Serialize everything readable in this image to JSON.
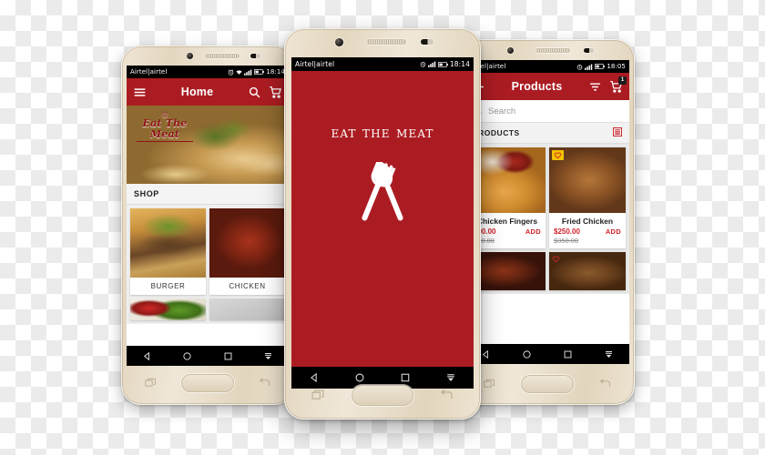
{
  "scene": {
    "background": "transparent-checkerboard",
    "brand_red": "#ab1c22",
    "accent_red": "#d0212a",
    "phone_body_color": "#e8dfd0"
  },
  "phones": {
    "left": {
      "status_bar": {
        "carrier": "Airtel|airtel",
        "time": "18:14"
      },
      "app_bar": {
        "menu_icon": "hamburger-menu-icon",
        "title": "Home",
        "search_icon": "search-icon",
        "cart_icon": "cart-icon"
      },
      "hero": {
        "logo_line1": "Eat The Meat",
        "crown": "♔"
      },
      "section_title": "SHOP",
      "categories": [
        {
          "label": "BURGER"
        },
        {
          "label": "CHICKEN"
        }
      ],
      "nav": [
        "back-triangle-icon",
        "home-circle-icon",
        "recents-square-icon",
        "hide-keyboard-icon"
      ]
    },
    "center": {
      "status_bar": {
        "carrier": "Airtel|airtel",
        "time": "18:14"
      },
      "splash": {
        "title": "Eat the Meat",
        "logo_icon": "fork-and-spoon-icon"
      },
      "nav": [
        "back-triangle-icon",
        "home-circle-icon",
        "recents-square-icon",
        "hide-keyboard-icon"
      ]
    },
    "right": {
      "status_bar": {
        "carrier": "Airtel|airtel",
        "time": "18:05"
      },
      "app_bar": {
        "back_icon": "back-arrow-icon",
        "title": "Products",
        "filter_icon": "filter-icon",
        "cart_icon": "cart-icon",
        "cart_badge": "1"
      },
      "search": {
        "placeholder": "Search",
        "icon": "search-icon",
        "value": ""
      },
      "list_header": {
        "label": "PRODUCTS",
        "view_toggle_icon": "list-view-icon"
      },
      "products": [
        {
          "name": "Chicken Fingers",
          "price": "200.00",
          "old_price": "250.00",
          "add_label": "ADD",
          "fav_icon": "heart-outline-icon"
        },
        {
          "name": "Fried Chicken",
          "price": "$250.00",
          "old_price": "$350.00",
          "add_label": "ADD",
          "fav_icon": "heart-outline-icon"
        }
      ],
      "nav": [
        "back-triangle-icon",
        "home-circle-icon",
        "recents-square-icon",
        "hide-keyboard-icon"
      ]
    }
  },
  "hardware": {
    "home_button": "physical-home-button",
    "recents_key": "recents-key",
    "back_key": "back-key",
    "camera": "front-camera",
    "speaker": "earpiece-speaker",
    "sensor": "proximity-sensor"
  }
}
